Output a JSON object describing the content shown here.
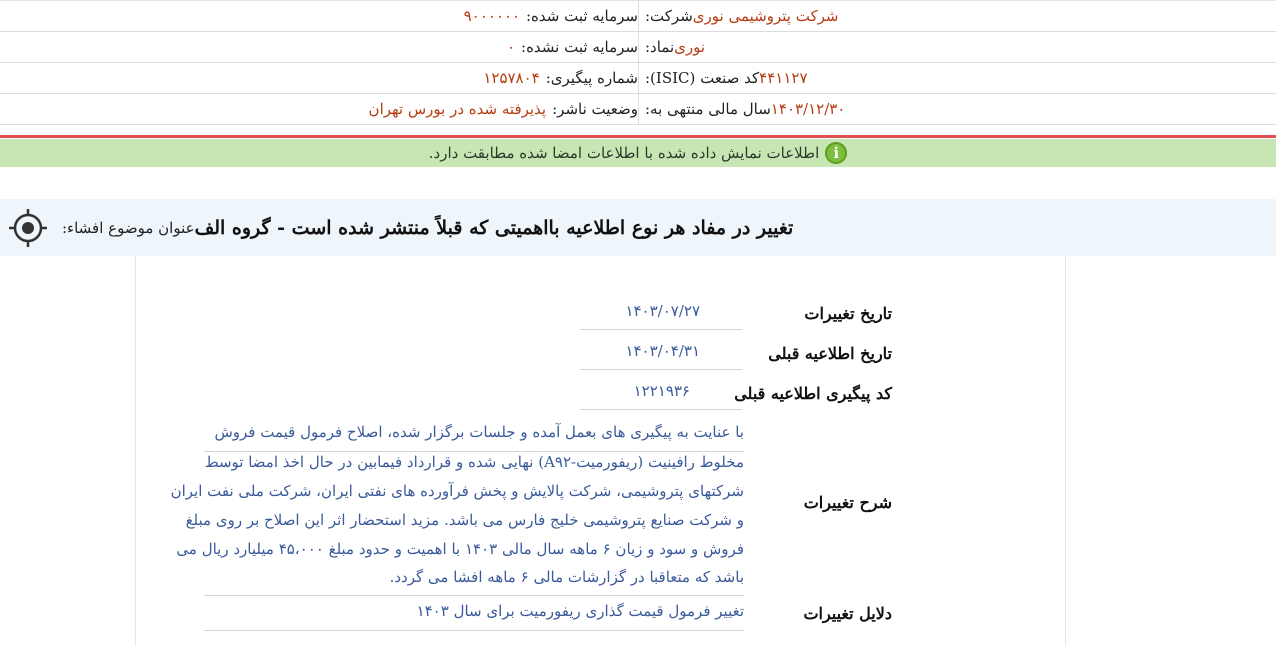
{
  "info": {
    "company_label": "شرکت:",
    "company_value": "شرکت پتروشیمی نوری",
    "symbol_label": "نماد:",
    "symbol_value": "نوری",
    "isic_label": "کد صنعت (ISIC):",
    "isic_value": "۴۴۱۱۲۷",
    "fiscal_label": "سال مالی منتهی به:",
    "fiscal_value": "۱۴۰۳/۱۲/۳۰",
    "reg_capital_label": "سرمایه ثبت شده:",
    "reg_capital_value": "۹۰۰۰۰۰۰",
    "unreg_capital_label": "سرمایه ثبت نشده:",
    "unreg_capital_value": "۰",
    "tracking_label": "شماره پیگیری:",
    "tracking_value": "۱۲۵۷۸۰۴",
    "publisher_status_label": "وضعیت ناشر:",
    "publisher_status_value": "پذیرفته شده در بورس تهران"
  },
  "notice": {
    "icon": "info-icon",
    "text": "اطلاعات نمایش داده شده با اطلاعات امضا شده مطابقت دارد."
  },
  "title": {
    "icon": "target-icon",
    "label": "عنوان موضوع افشاء:",
    "text": "تغییر در مفاد هر نوع اطلاعیه بااهمیتی که قبلاً منتشر شده است - گروه الف"
  },
  "fields": {
    "change_date_label": "تاریخ تغییرات",
    "change_date_value": "۱۴۰۳/۰۷/۲۷",
    "prev_notice_date_label": "تاریخ اطلاعیه قبلی",
    "prev_notice_date_value": "۱۴۰۳/۰۴/۳۱",
    "prev_tracking_label": "کد پیگیری اطلاعیه قبلی",
    "prev_tracking_value": "۱۲۲۱۹۳۶",
    "desc_label": "شرح تغییرات",
    "desc_lines": [
      "با عنایت به پیگیری های بعمل آمده و جلسات برگزار شده، اصلاح فرمول قیمت فروش",
      "مخلوط رافینیت (ریفورمیت-A۹۲) نهایی شده و قرارداد فیمابین در حال اخذ امضا توسط",
      "شرکتهای پتروشیمی، شرکت پالایش و پخش فرآورده های نفتی ایران، شرکت ملی نفت ایران",
      "و شرکت صنایع پتروشیمی خلیج فارس می باشد. مزید استحضار اثر این اصلاح بر روی مبلغ",
      "فروش و سود و زیان ۶ ماهه سال مالی ۱۴۰۳ با اهمیت و حدود مبلغ ۴۵،۰۰۰ میلیارد ریال می",
      "باشد که متعاقبا در گزارشات مالی ۶ ماهه افشا می گردد."
    ],
    "reasons_label": "دلایل تغییرات",
    "reasons_value": "تغییر فرمول قیمت گذاری ریفورمیت برای سال ۱۴۰۳"
  }
}
